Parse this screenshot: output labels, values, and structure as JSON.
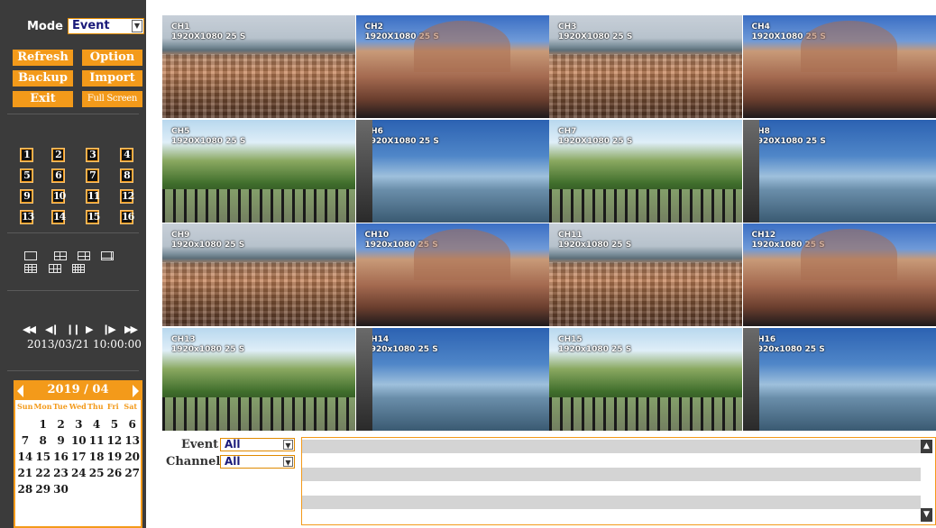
{
  "sidebar": {
    "mode_label": "Mode",
    "mode_value": "Event",
    "buttons": {
      "refresh": "Refresh",
      "option": "Option",
      "backup": "Backup",
      "import": "Import",
      "exit": "Exit",
      "full_screen": "Full Screen"
    },
    "channels": [
      "1",
      "2",
      "3",
      "4",
      "5",
      "6",
      "7",
      "8",
      "9",
      "10",
      "11",
      "12",
      "13",
      "14",
      "15",
      "16"
    ],
    "layouts": [
      "layout-1-icon",
      "layout-4-icon",
      "layout-6-icon",
      "layout-8-icon",
      "layout-9-icon",
      "layout-10-icon",
      "layout-16-icon"
    ],
    "playback": {
      "fast_rewind": "◀◀",
      "step_back": "◀❙",
      "pause": "❙❙",
      "play": "▶",
      "step_forward": "❙▶",
      "fast_forward": "▶▶"
    },
    "datetime": "2013/03/21 10:00:00"
  },
  "calendar": {
    "title": "2019 / 04",
    "weekdays": [
      "Sun",
      "Mon",
      "Tue",
      "Wed",
      "Thu",
      "Fri",
      "Sat"
    ],
    "weeks": [
      [
        "",
        "1",
        "2",
        "3",
        "4",
        "5",
        "6"
      ],
      [
        "7",
        "8",
        "9",
        "10",
        "11",
        "12",
        "13"
      ],
      [
        "14",
        "15",
        "16",
        "17",
        "18",
        "19",
        "20"
      ],
      [
        "21",
        "22",
        "23",
        "24",
        "25",
        "26",
        "27"
      ],
      [
        "28",
        "29",
        "30",
        "",
        "",
        "",
        ""
      ]
    ]
  },
  "tiles": [
    {
      "name": "CH1",
      "res": "1920X1080 25 S",
      "scene": "city"
    },
    {
      "name": "CH2",
      "res": "1920X1080 25 S",
      "scene": "mosque"
    },
    {
      "name": "CH3",
      "res": "1920X1080 25 S",
      "scene": "city"
    },
    {
      "name": "CH4",
      "res": "1920X1080 25 S",
      "scene": "mosque"
    },
    {
      "name": "CH5",
      "res": "1920X1080 25 S",
      "scene": "tree"
    },
    {
      "name": "CH6",
      "res": "1920X1080 25 S",
      "scene": "sea"
    },
    {
      "name": "CH7",
      "res": "1920X1080 25 S",
      "scene": "tree"
    },
    {
      "name": "CH8",
      "res": "1920X1080 25 S",
      "scene": "sea"
    },
    {
      "name": "CH9",
      "res": "1920x1080 25 S",
      "scene": "city"
    },
    {
      "name": "CH10",
      "res": "1920x1080 25 S",
      "scene": "mosque"
    },
    {
      "name": "CH11",
      "res": "1920x1080 25 S",
      "scene": "city"
    },
    {
      "name": "CH12",
      "res": "1920x1080 25 S",
      "scene": "mosque"
    },
    {
      "name": "CH13",
      "res": "1920x1080 25 S",
      "scene": "tree"
    },
    {
      "name": "CH14",
      "res": "1920x1080 25 S",
      "scene": "sea"
    },
    {
      "name": "CH15",
      "res": "1920x1080 25 S",
      "scene": "tree"
    },
    {
      "name": "CH16",
      "res": "1920x1080 25 S",
      "scene": "sea"
    }
  ],
  "filters": {
    "event_label": "Event",
    "event_value": "All",
    "channel_label": "Channel",
    "channel_value": "All"
  },
  "colors": {
    "accent": "#f39a1a",
    "sidebar_bg": "#3b3b3b"
  }
}
